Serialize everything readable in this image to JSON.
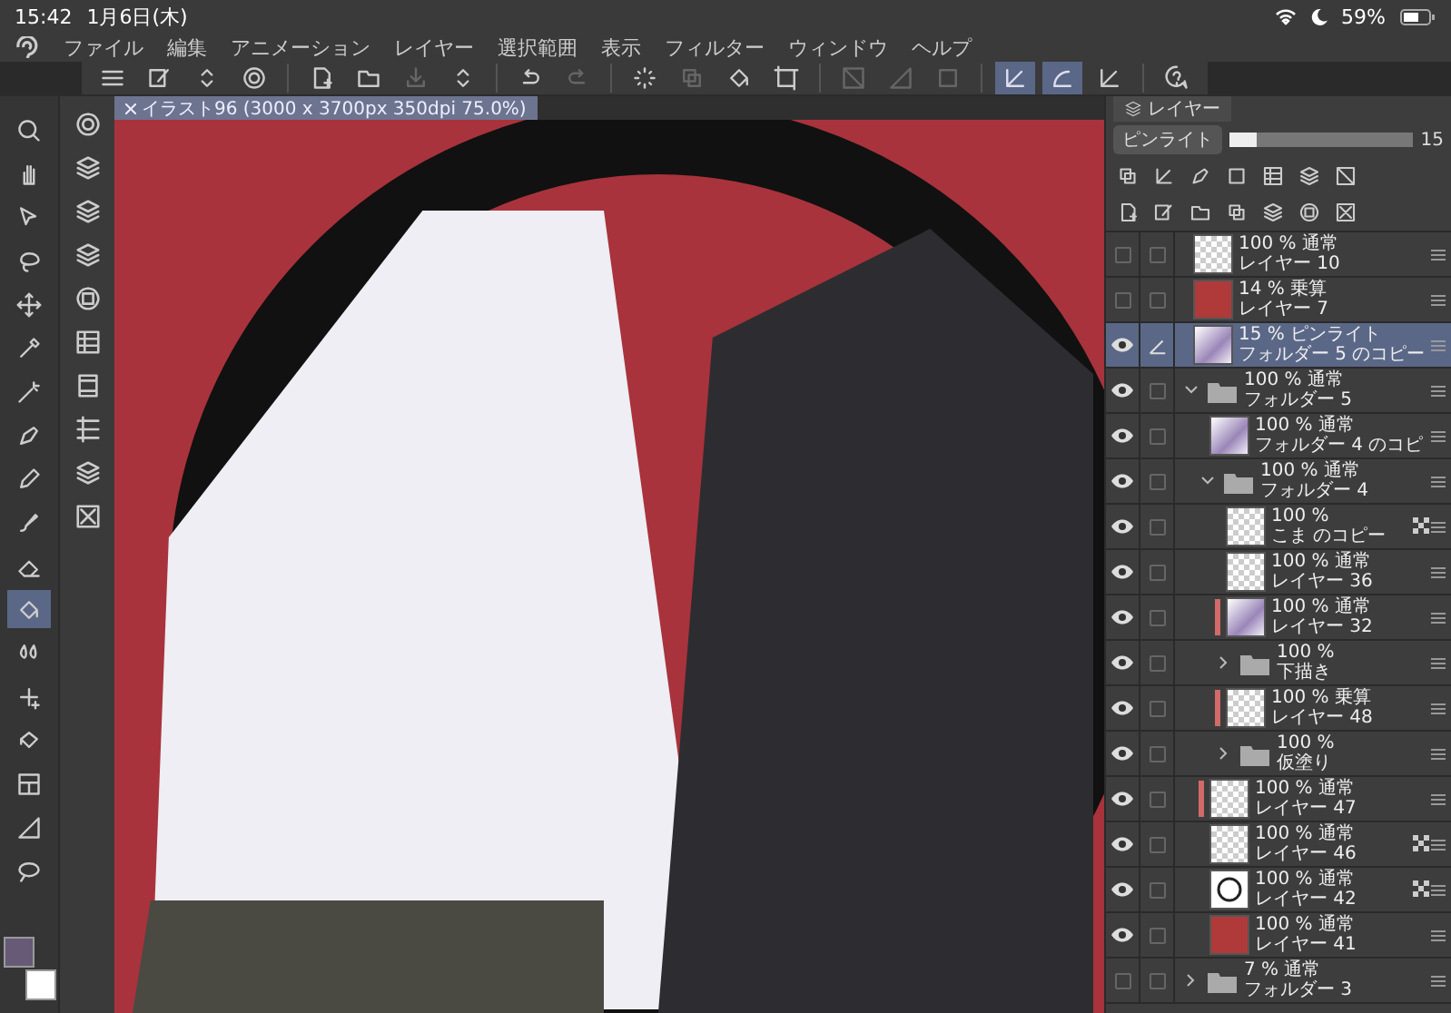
{
  "status_bar": {
    "time": "15:42",
    "date": "1月6日(木)",
    "battery": "59%"
  },
  "menu": [
    "ファイル",
    "編集",
    "アニメーション",
    "レイヤー",
    "選択範囲",
    "表示",
    "フィルター",
    "ウィンドウ",
    "ヘルプ"
  ],
  "toolbar": [
    {
      "kind": "menu",
      "disabled": false,
      "selected": false
    },
    {
      "kind": "edit",
      "disabled": false,
      "selected": false
    },
    {
      "kind": "updown",
      "disabled": false,
      "selected": false
    },
    {
      "kind": "target",
      "disabled": false,
      "selected": false
    },
    {
      "kind": "sep"
    },
    {
      "kind": "newfile",
      "disabled": false,
      "selected": false
    },
    {
      "kind": "folder",
      "disabled": false,
      "selected": false
    },
    {
      "kind": "save",
      "disabled": true,
      "selected": false
    },
    {
      "kind": "updown",
      "disabled": false,
      "selected": false
    },
    {
      "kind": "sep"
    },
    {
      "kind": "undo",
      "disabled": false,
      "selected": false
    },
    {
      "kind": "redo",
      "disabled": true,
      "selected": false
    },
    {
      "kind": "sep"
    },
    {
      "kind": "dotted",
      "disabled": false,
      "selected": false
    },
    {
      "kind": "copy",
      "disabled": true,
      "selected": false
    },
    {
      "kind": "fill",
      "disabled": false,
      "selected": false
    },
    {
      "kind": "crop",
      "disabled": false,
      "selected": false
    },
    {
      "kind": "sep"
    },
    {
      "kind": "slash",
      "disabled": true,
      "selected": false
    },
    {
      "kind": "gradient",
      "disabled": true,
      "selected": false
    },
    {
      "kind": "square",
      "disabled": true,
      "selected": false
    },
    {
      "kind": "sep"
    },
    {
      "kind": "ruler",
      "disabled": false,
      "selected": true
    },
    {
      "kind": "curve",
      "disabled": false,
      "selected": true
    },
    {
      "kind": "ruler",
      "disabled": false,
      "selected": false
    },
    {
      "kind": "sep"
    },
    {
      "kind": "help",
      "disabled": false,
      "selected": false
    }
  ],
  "tools": [
    {
      "kind": "zoom",
      "selected": false
    },
    {
      "kind": "hand",
      "selected": false
    },
    {
      "kind": "cursor",
      "selected": false
    },
    {
      "kind": "lasso",
      "selected": false
    },
    {
      "kind": "move",
      "selected": false
    },
    {
      "kind": "eyedropper",
      "selected": false
    },
    {
      "kind": "wand",
      "selected": false
    },
    {
      "kind": "pen",
      "selected": false
    },
    {
      "kind": "pencil",
      "selected": false
    },
    {
      "kind": "brush",
      "selected": false
    },
    {
      "kind": "eraser",
      "selected": false
    },
    {
      "kind": "fill",
      "selected": true
    },
    {
      "kind": "blend",
      "selected": false
    },
    {
      "kind": "sparkle",
      "selected": false
    },
    {
      "kind": "bucket",
      "selected": false
    },
    {
      "kind": "frame",
      "selected": false
    },
    {
      "kind": "gradient",
      "selected": false
    },
    {
      "kind": "balloon",
      "selected": false
    }
  ],
  "sub_tools": [
    {
      "kind": "target"
    },
    {
      "kind": "layers"
    },
    {
      "kind": "layers"
    },
    {
      "kind": "layers"
    },
    {
      "kind": "circle"
    },
    {
      "kind": "grid"
    },
    {
      "kind": "film"
    },
    {
      "kind": "list"
    },
    {
      "kind": "layers"
    },
    {
      "kind": "closebox"
    }
  ],
  "color_swatches": [
    {
      "kind": "main",
      "color": "#675a77"
    },
    {
      "kind": "sub",
      "color": "#ffffff"
    }
  ],
  "document_tab": {
    "title": "イラスト96 (3000 x 3700px 350dpi 75.0%)"
  },
  "layer_panel": {
    "tab": "レイヤー",
    "blend_mode": "ピンライト",
    "opacity": {
      "level": 0.15,
      "reading": "15"
    },
    "layers": [
      {
        "kind": "layer",
        "mode": "100 % 通常",
        "name": "レイヤー 10",
        "visible": false,
        "selected": false,
        "thumbnail": {
          "kind": "checker"
        },
        "clipped": false,
        "badge": false
      },
      {
        "kind": "layer",
        "mode": "14 % 乗算",
        "name": "レイヤー 7",
        "visible": false,
        "selected": false,
        "thumbnail": {
          "kind": "red"
        },
        "clipped": false,
        "badge": false
      },
      {
        "kind": "layer",
        "mode": "15 % ピンライト",
        "name": "フォルダー 5 のコピー",
        "visible": true,
        "selected": true,
        "thumbnail": {
          "kind": "art"
        },
        "clipped": false,
        "badge": false
      },
      {
        "kind": "folder",
        "mode": "100 % 通常",
        "name": "フォルダー 5",
        "visible": true,
        "selected": false,
        "expanded": true,
        "children": [
          {
            "kind": "layer",
            "mode": "100 % 通常",
            "name": "フォルダー 4 のコピ",
            "visible": true,
            "selected": false,
            "thumbnail": {
              "kind": "art"
            },
            "clipped": false,
            "badge": false
          },
          {
            "kind": "folder",
            "mode": "100 % 通常",
            "name": "フォルダー 4",
            "visible": true,
            "selected": false,
            "expanded": true,
            "children": [
              {
                "kind": "layer",
                "mode": "100 %",
                "name": "こま のコピー",
                "visible": true,
                "selected": false,
                "thumbnail": {
                  "kind": "checker"
                },
                "clipped": false,
                "badge": true
              },
              {
                "kind": "layer",
                "mode": "100 % 通常",
                "name": "レイヤー 36",
                "visible": true,
                "selected": false,
                "thumbnail": {
                  "kind": "checker"
                },
                "clipped": false,
                "badge": false
              },
              {
                "kind": "layer",
                "mode": "100 % 通常",
                "name": "レイヤー 32",
                "visible": true,
                "selected": false,
                "thumbnail": {
                  "kind": "art"
                },
                "clipped": true,
                "badge": false
              },
              {
                "kind": "folder",
                "mode": "100 %",
                "name": "下描き",
                "visible": true,
                "selected": false,
                "expanded": false
              },
              {
                "kind": "layer",
                "mode": "100 % 乗算",
                "name": "レイヤー 48",
                "visible": true,
                "selected": false,
                "thumbnail": {
                  "kind": "checker"
                },
                "clipped": true,
                "badge": false
              },
              {
                "kind": "folder",
                "mode": "100 %",
                "name": "仮塗り",
                "visible": true,
                "selected": false,
                "expanded": false
              }
            ]
          },
          {
            "kind": "layer",
            "mode": "100 % 通常",
            "name": "レイヤー 47",
            "visible": true,
            "selected": false,
            "thumbnail": {
              "kind": "checker"
            },
            "clipped": true,
            "badge": false
          },
          {
            "kind": "layer",
            "mode": "100 % 通常",
            "name": "レイヤー 46",
            "visible": true,
            "selected": false,
            "thumbnail": {
              "kind": "checker"
            },
            "clipped": false,
            "badge": true
          },
          {
            "kind": "layer",
            "mode": "100 % 通常",
            "name": "レイヤー 42",
            "visible": true,
            "selected": false,
            "thumbnail": {
              "kind": "circle"
            },
            "clipped": false,
            "badge": true
          },
          {
            "kind": "layer",
            "mode": "100 % 通常",
            "name": "レイヤー 41",
            "visible": true,
            "selected": false,
            "thumbnail": {
              "kind": "red"
            },
            "clipped": false,
            "badge": false
          }
        ]
      },
      {
        "kind": "folder",
        "mode": "7 % 通常",
        "name": "フォルダー 3",
        "visible": false,
        "selected": false,
        "expanded": false
      }
    ]
  }
}
